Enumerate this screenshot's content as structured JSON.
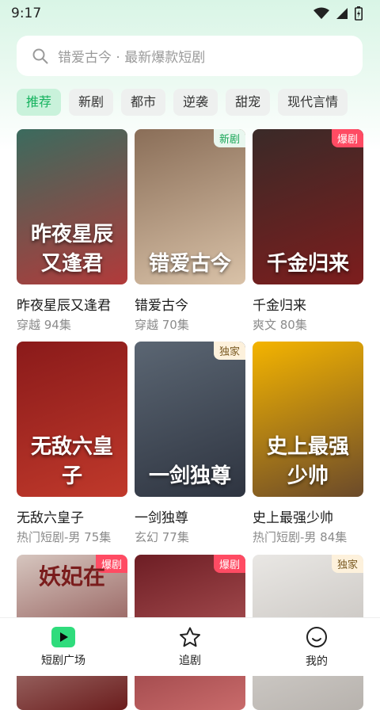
{
  "status_bar": {
    "time": "9:17"
  },
  "search": {
    "placeholder": "错爱古今 · 最新爆款短剧"
  },
  "categories": [
    {
      "label": "推荐",
      "active": true
    },
    {
      "label": "新剧"
    },
    {
      "label": "都市"
    },
    {
      "label": "逆袭"
    },
    {
      "label": "甜宠"
    },
    {
      "label": "现代言情"
    }
  ],
  "dramas": [
    {
      "title": "昨夜星辰又逢君",
      "meta": "穿越 94集",
      "badge": "",
      "poster_text": "昨夜星辰又逢君",
      "colors": [
        "#3b6b5e",
        "#b23a3a"
      ]
    },
    {
      "title": "错爱古今",
      "meta": "穿越 70集",
      "badge": "新剧",
      "poster_text": "错爱古今",
      "colors": [
        "#8a6e58",
        "#d9c2a8"
      ]
    },
    {
      "title": "千金归来",
      "meta": "爽文 80集",
      "badge": "爆剧",
      "poster_text": "千金归来",
      "colors": [
        "#3a2a28",
        "#7d1d1d"
      ]
    },
    {
      "title": "无敌六皇子",
      "meta": "热门短剧-男 75集",
      "badge": "",
      "poster_text": "无敌六皇子",
      "colors": [
        "#8a1a1a",
        "#c0392b"
      ]
    },
    {
      "title": "一剑独尊",
      "meta": "玄幻 77集",
      "badge": "独家",
      "poster_text": "一剑独尊",
      "colors": [
        "#5b6673",
        "#2e3440"
      ]
    },
    {
      "title": "史上最强少帅",
      "meta": "热门短剧-男 84集",
      "badge": "",
      "poster_text": "史上最强少帅",
      "colors": [
        "#f4b400",
        "#6b4a2a"
      ]
    },
    {
      "title": "",
      "meta": "",
      "badge": "爆剧",
      "poster_text": "妖妃在",
      "colors": [
        "#d6c6bf",
        "#6b1d1d"
      ]
    },
    {
      "title": "",
      "meta": "",
      "badge": "爆剧",
      "poster_text": "",
      "colors": [
        "#6d1d24",
        "#c96b6b"
      ]
    },
    {
      "title": "",
      "meta": "",
      "badge": "独家",
      "poster_text": "",
      "colors": [
        "#e9e7e4",
        "#b7b2ad"
      ]
    }
  ],
  "tabbar": [
    {
      "label": "短剧广场",
      "icon": "play-icon",
      "active": true
    },
    {
      "label": "追剧",
      "icon": "star-icon"
    },
    {
      "label": "我的",
      "icon": "smile-icon"
    }
  ],
  "theme": {
    "accent": "#16b35f",
    "hot_badge": "#ff4b63"
  }
}
